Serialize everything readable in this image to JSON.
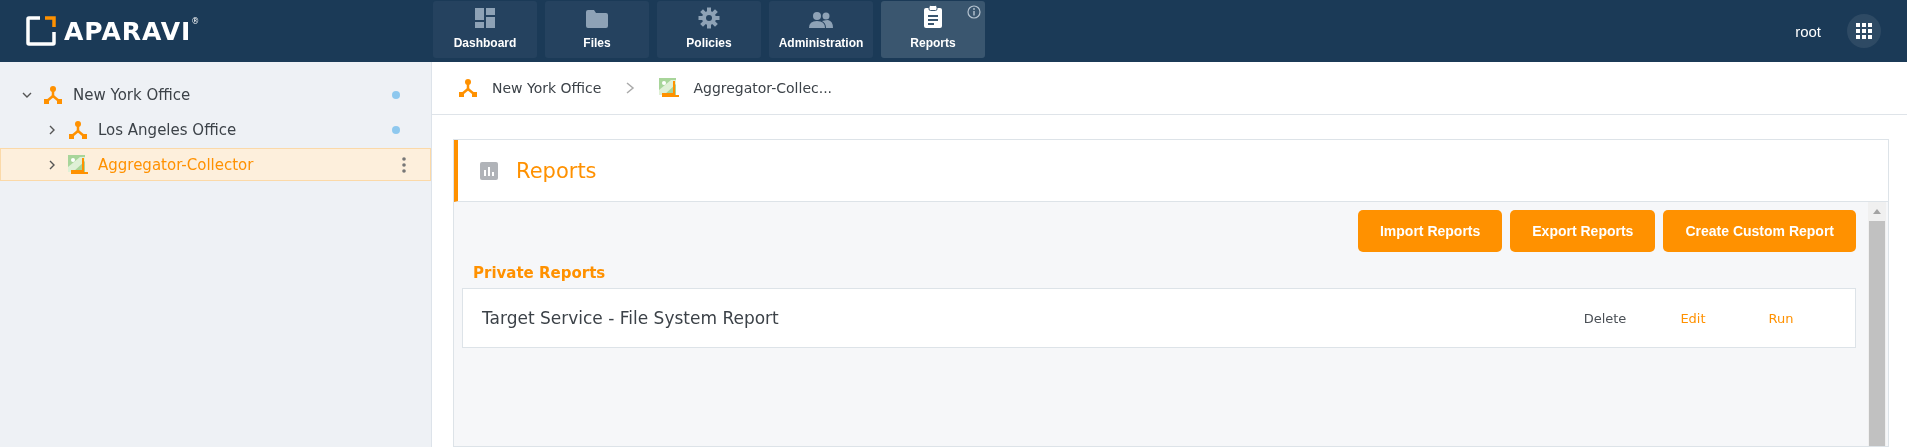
{
  "header": {
    "logo": "APARAVI$^{®}$",
    "nav": [
      {
        "label": "Dashboard",
        "kind": "dashboard",
        "selected": false,
        "info": false
      },
      {
        "label": "Files",
        "kind": "folder",
        "selected": false,
        "info": false
      },
      {
        "label": "Policies",
        "kind": "gear",
        "selected": false,
        "info": false
      },
      {
        "label": "Administration",
        "kind": "people",
        "selected": false,
        "info": false
      },
      {
        "label": "Reports",
        "kind": "clipboard",
        "selected": true,
        "info": true
      }
    ],
    "user": "root"
  },
  "sidebar": {
    "tree": [
      {
        "label": "New York Office",
        "kind": "office",
        "expanded": true,
        "selected": false,
        "online": true,
        "children": [
          {
            "label": "Los Angeles Office",
            "kind": "office",
            "expanded": false,
            "selected": false,
            "online": true
          },
          {
            "label": "Aggregator-Collector",
            "kind": "collector",
            "expanded": false,
            "selected": true,
            "online": false
          }
        ]
      }
    ]
  },
  "breadcrumb": [
    {
      "label": "New York Office",
      "kind": "office"
    },
    {
      "label": "Aggregator-Collec...",
      "kind": "collector"
    }
  ],
  "panel": {
    "title": "Reports",
    "buttons": [
      "Import Reports",
      "Export Reports",
      "Create Custom Report"
    ],
    "section": "Private Reports",
    "reports": [
      {
        "name": "Target Service - File System Report",
        "actions": [
          {
            "label": "Delete",
            "kind": "neutral"
          },
          {
            "label": "Edit",
            "kind": "primary"
          },
          {
            "label": "Run",
            "kind": "primary"
          }
        ]
      }
    ]
  }
}
